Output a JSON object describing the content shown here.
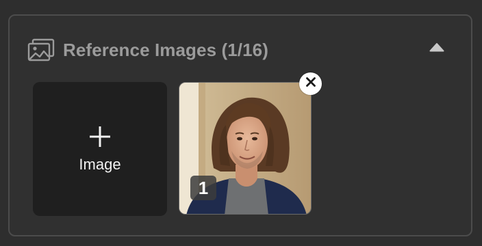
{
  "section": {
    "title": "Reference Images (1/16)",
    "header_icon": "images-icon",
    "collapse_icon": "caret-up-icon"
  },
  "add_tile": {
    "label": "Image",
    "icon": "plus-icon"
  },
  "thumbnails": [
    {
      "badge": "1",
      "remove_icon": "close-icon"
    }
  ],
  "colors": {
    "background": "#2e2e2e",
    "panel_border": "#4c4c4c",
    "title": "#9b9b9b",
    "tile": "#1f1f1f"
  }
}
